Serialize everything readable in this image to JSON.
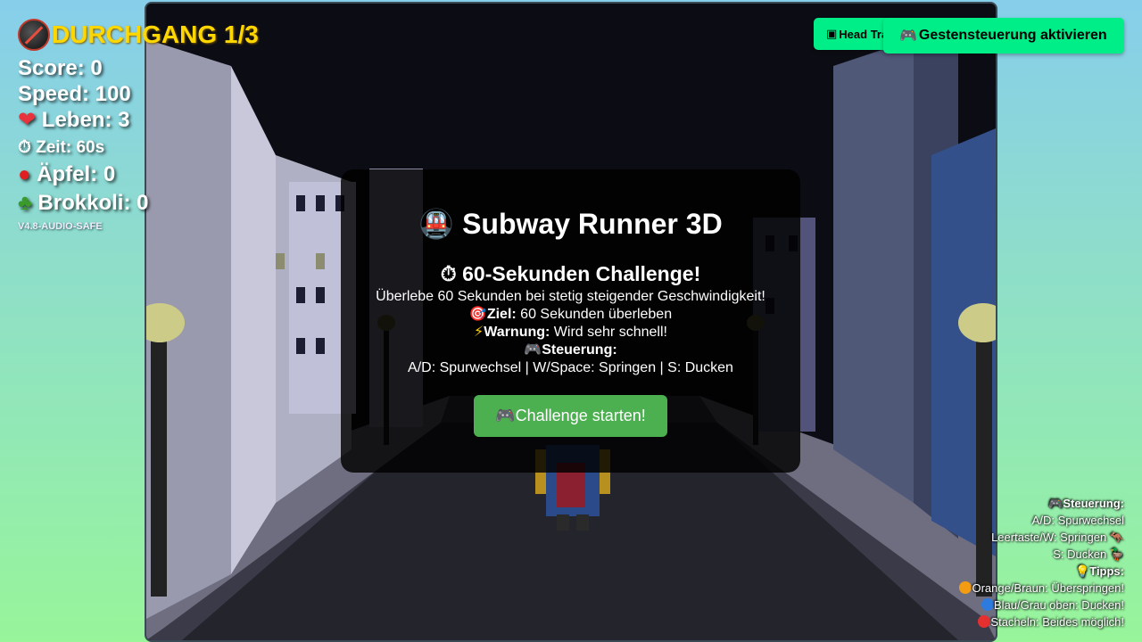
{
  "hud": {
    "pass": "DURCHGANG 1/3",
    "score": "Score: 0",
    "speed": "Speed: 100",
    "lives": "Leben: 3",
    "time": "Zeit: 60s",
    "apples": "Äpfel: 0",
    "broccoli": "Brokkoli: 0",
    "version": "V4.8-AUDIO-SAFE"
  },
  "buttons": {
    "head_tracking": "Head Tracking",
    "gesture": "Gestensteuerung aktivieren"
  },
  "modal": {
    "title": "Subway Runner 3D",
    "subtitle": "60-Sekunden Challenge!",
    "description": "Überlebe 60 Sekunden bei stetig steigender Geschwindigkeit!",
    "goal_label": "Ziel:",
    "goal_text": " 60 Sekunden überleben",
    "warning_label": "Warnung:",
    "warning_text": " Wird sehr schnell!",
    "controls_label": "Steuerung:",
    "controls_text": "A/D: Spurwechsel | W/Space: Springen | S: Ducken",
    "start_button": "Challenge starten!"
  },
  "help": {
    "controls_title": "Steuerung:",
    "lane_change": "A/D: Spurwechsel",
    "jump": "Leertaste/W: Springen",
    "duck": "S: Ducken",
    "tips_title": "Tipps:",
    "tip_orange": "Orange/Braun: Überspringen!",
    "tip_blue": "Blau/Grau oben: Ducken!",
    "tip_red": "Stacheln: Beides möglich!"
  },
  "colors": {
    "accent_gold": "#ffd700",
    "button_green": "#00ee88",
    "start_green": "#4caf50"
  }
}
